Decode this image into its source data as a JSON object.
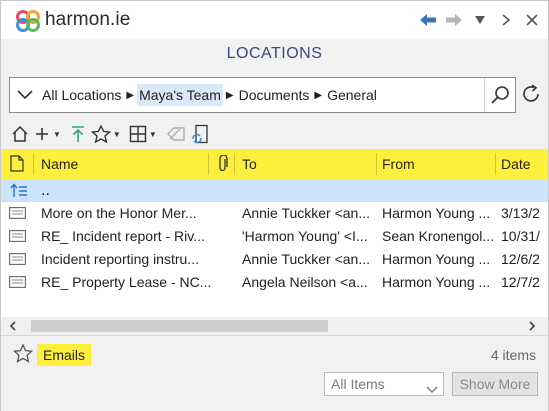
{
  "app": {
    "brand": "harmon.ie"
  },
  "header": {
    "title": "LOCATIONS"
  },
  "breadcrumb": {
    "items": [
      "All Locations",
      "Maya's Team",
      "Documents",
      "General"
    ],
    "selected_index": 1
  },
  "table": {
    "columns": [
      "Name",
      "To",
      "From",
      "Date"
    ],
    "parent_row": "..",
    "rows": [
      {
        "name": "More on the Honor Mer...",
        "to": "Annie Tuckker <an...",
        "from": "Harmon Young ...",
        "date": "3/13/2"
      },
      {
        "name": "RE_ Incident report - Riv...",
        "to": "'Harmon Young' <I...",
        "from": "Sean Kronengol...",
        "date": "10/31/"
      },
      {
        "name": "Incident reporting instru...",
        "to": "Annie Tuckker <an...",
        "from": "Harmon Young ...",
        "date": "12/6/2"
      },
      {
        "name": "RE_ Property Lease - NC...",
        "to": "Angela Neilson <a...",
        "from": "Harmon Young ...",
        "date": "12/7/2"
      }
    ]
  },
  "footer": {
    "favorite_label": "Emails",
    "count": "4 items",
    "filter_value": "All Items",
    "show_more": "Show More"
  },
  "colors": {
    "highlight": "#ffef3d",
    "selection": "#cce4fb",
    "accent_blue": "#3f73b8",
    "header_text": "#3c4a7a"
  }
}
